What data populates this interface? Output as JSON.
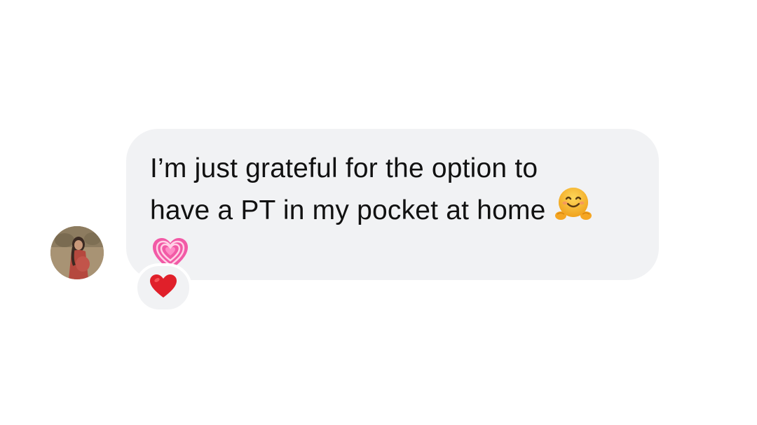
{
  "message": {
    "line1": "I’m just grateful for the option to",
    "line2": "have a PT in my pocket at home",
    "inline_emoji": "hugging-face-icon",
    "trailing_emoji": "growing-heart-icon"
  },
  "reaction": {
    "emoji": "red-heart-icon"
  },
  "avatar": {
    "icon": "profile-photo"
  },
  "colors": {
    "bubble": "#f1f2f4",
    "text": "#111111",
    "background": "#ffffff",
    "heart": "#e0202a",
    "pink_heart": "#f25aa6",
    "hug_face": "#f7b731"
  }
}
